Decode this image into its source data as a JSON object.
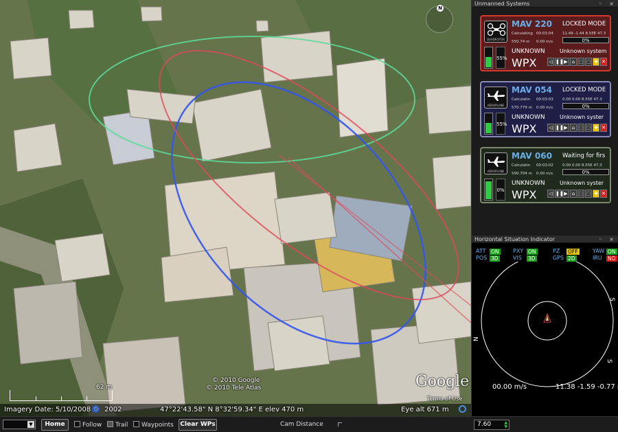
{
  "map": {
    "copyright_1": "© 2010 Google",
    "copyright_2": "© 2010 Tele Atlas",
    "scale_label": "62 m",
    "imagery_date": "Imagery Date: 5/10/2008",
    "year": "2002",
    "coords": "47°22'43.58\" N   8°32'59.34\" E  elev  470 m",
    "eye_alt": "Eye alt    671 m",
    "logo": "Google",
    "terms": "Terms of Use",
    "compass_n": "N"
  },
  "uas_panel": {
    "title": "Unmanned Systems",
    "header_buttons": "◦ ×",
    "mavs": [
      {
        "name": "MAV 220",
        "type_label": "QUADROTOR",
        "icon": "quadrotor-icon",
        "mode": "LOCKED MODE",
        "calc": "Calculating",
        "time": "00:03:04",
        "coords": "11.49 -1.44  8.55E 47.3",
        "alt": "550.74 m",
        "speed": "0.00 m/s",
        "progress": "0%",
        "state": "UNKNOWN",
        "system": "Unknown system",
        "battery_pct": "55%",
        "battery_level": 0.55,
        "wpx": "WPX",
        "border_color": "#d63a2f",
        "bg_color": "#5a1c1c"
      },
      {
        "name": "MAV 054",
        "type_label": "AEROPLANE",
        "icon": "aeroplane-icon",
        "mode": "LOCKED MODE",
        "calc": "Calculatin",
        "time": "00:03:03",
        "coords": "0.00 0.00  8.55E 47.3",
        "alt": "570.779 m",
        "speed": "0.00 m/s",
        "progress": "0%",
        "state": "UNKNOWN",
        "system": "Unknown syster",
        "battery_pct": "55%",
        "battery_level": 0.55,
        "wpx": "WPX",
        "border_color": "#8a8ab8",
        "bg_color": "#1e1e46"
      },
      {
        "name": "MAV 060",
        "type_label": "AEROPLANE",
        "icon": "aeroplane-icon",
        "mode": "Waiting for firs",
        "calc": "Calculatin",
        "time": "00:03:02",
        "coords": "0.00 0.00  8.55E 47.3",
        "alt": "590.704 m",
        "speed": "0.00 m/s",
        "progress": "0%",
        "state": "UNKNOWN",
        "system": "Unknown syster",
        "battery_pct": "0%",
        "battery_level": 0.92,
        "wpx": "WPX",
        "border_color": "#7a8a6a",
        "bg_color": "#1f2a1c"
      }
    ],
    "controls": [
      "◁",
      "❚❚",
      "▶",
      "⌂",
      "⬚",
      "⬚",
      "✚",
      "✕"
    ]
  },
  "hsi": {
    "title": "Horizontal Situation Indicator",
    "header_buttons": "◦ ×",
    "flags": [
      {
        "label": "ATT",
        "value": "ON",
        "status": "g"
      },
      {
        "label": "PXY",
        "value": "ON",
        "status": "g"
      },
      {
        "label": "PZ",
        "value": "OFF",
        "status": "y"
      },
      {
        "label": "YAW",
        "value": "ON",
        "status": "g"
      },
      {
        "label": "POS",
        "value": "3D",
        "status": "g"
      },
      {
        "label": "VIS",
        "value": "3D",
        "status": "g"
      },
      {
        "label": "GPS",
        "value": "2D",
        "status": "g"
      },
      {
        "label": "IRU",
        "value": "NO",
        "status": "r"
      }
    ],
    "speed": "00.00 m/s",
    "position": "11.38 -1.59 -0.77 m",
    "compass_labels": [
      "N",
      "S",
      "S"
    ]
  },
  "toolbar": {
    "home": "Home",
    "follow": "Follow",
    "trail": "Trail",
    "waypoints": "Waypoints",
    "clear_wps": "Clear WPs",
    "cam_distance": "Cam Distance",
    "spin_value": "7.60"
  }
}
